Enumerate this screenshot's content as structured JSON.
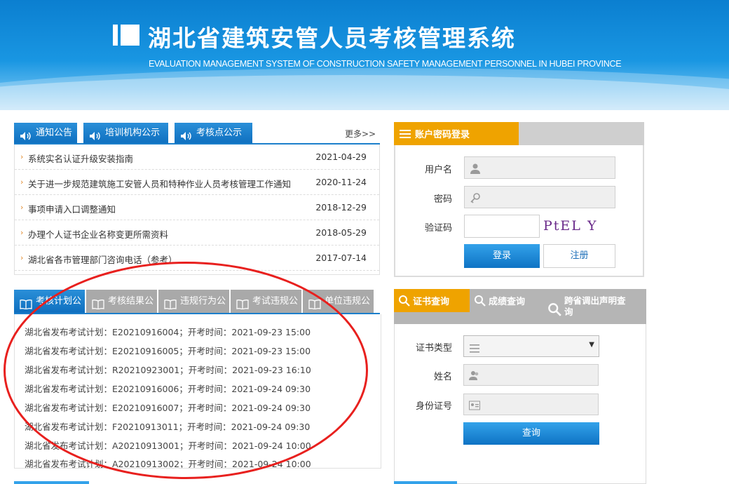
{
  "header": {
    "title": "湖北省建筑安管人员考核管理系统",
    "subtitle": "EVALUATION MANAGEMENT SYSTEM OF CONSTRUCTION SAFETY MANAGEMENT PERSONNEL IN HUBEI PROVINCE"
  },
  "news": {
    "tabs": [
      "通知公告",
      "培训机构公示",
      "考核点公示"
    ],
    "more": "更多>>",
    "items": [
      {
        "title": "系统实名认证升级安装指南",
        "date": "2021-04-29"
      },
      {
        "title": "关于进一步规范建筑施工安管人员和特种作业人员考核管理工作通知",
        "date": "2020-11-24"
      },
      {
        "title": "事项申请入口调整通知",
        "date": "2018-12-29"
      },
      {
        "title": "办理个人证书企业名称变更所需资料",
        "date": "2018-05-29"
      },
      {
        "title": "湖北省各市管理部门咨询电话（参考）",
        "date": "2017-07-14"
      }
    ]
  },
  "plans": {
    "tabs": [
      "考核计划公",
      "考核结果公",
      "违规行为公",
      "考试违规公",
      "单位违规公"
    ],
    "items": [
      "湖北省发布考试计划：E20210916004；开考时间：2021-09-23 15:00",
      "湖北省发布考试计划：E20210916005；开考时间：2021-09-23 15:00",
      "湖北省发布考试计划：R20210923001；开考时间：2021-09-23 16:10",
      "湖北省发布考试计划：E20210916006；开考时间：2021-09-24 09:30",
      "湖北省发布考试计划：E20210916007；开考时间：2021-09-24 09:30",
      "湖北省发布考试计划：F20210913011；开考时间：2021-09-24 09:30",
      "湖北省发布考试计划：A20210913001；开考时间：2021-09-24 10:00",
      "湖北省发布考试计划：A20210913002；开考时间：2021-09-24 10:00"
    ]
  },
  "login": {
    "header": "账户密码登录",
    "username_label": "用户名",
    "password_label": "密码",
    "captcha_label": "验证码",
    "captcha_text": "PtEL Y",
    "login_button": "登录",
    "register_button": "注册"
  },
  "query": {
    "tabs": [
      "证书查询",
      "成绩查询",
      "跨省调出声明查询"
    ],
    "cert_type_label": "证书类型",
    "name_label": "姓名",
    "id_label": "身份证号",
    "query_button": "查询"
  },
  "colors": {
    "primary_blue": "#0e6fbf",
    "accent_orange": "#efa300",
    "annotation_red": "#e8201e"
  }
}
